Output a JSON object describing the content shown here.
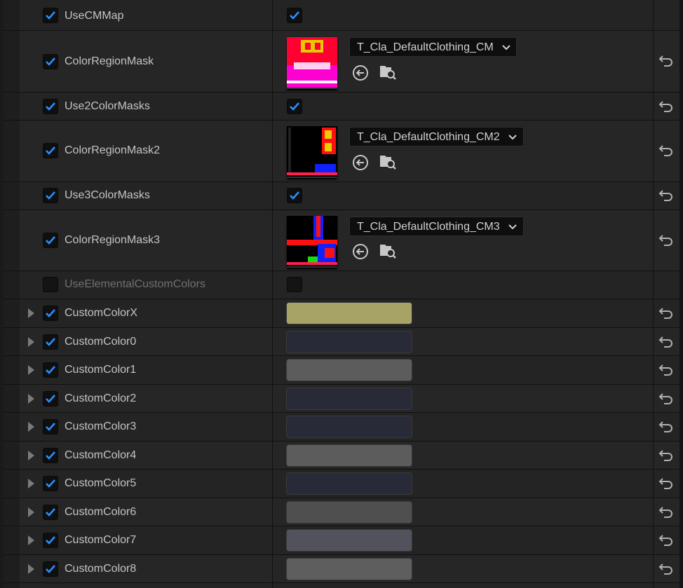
{
  "colors": {
    "accent": "#1e7fe0",
    "check": "#2a8fff",
    "swatch_x": "#a7a364",
    "swatch_navy": "#282b37",
    "swatch_gray": "#5c5c5c",
    "swatch_darkgray": "#4f4f4f"
  },
  "rows": {
    "usecmmap": {
      "label": "UseCMMap"
    },
    "colorregionmask": {
      "label": "ColorRegionMask",
      "asset": "T_Cla_DefaultClothing_CM"
    },
    "use2colormasks": {
      "label": "Use2ColorMasks"
    },
    "colorregionmask2": {
      "label": "ColorRegionMask2",
      "asset": "T_Cla_DefaultClothing_CM2"
    },
    "use3colormasks": {
      "label": "Use3ColorMasks"
    },
    "colorregionmask3": {
      "label": "ColorRegionMask3",
      "asset": "T_Cla_DefaultClothing_CM3"
    },
    "useelemental": {
      "label": "UseElementalCustomColors"
    },
    "customcolorx": {
      "label": "CustomColorX"
    },
    "customcolor0": {
      "label": "CustomColor0"
    },
    "customcolor1": {
      "label": "CustomColor1"
    },
    "customcolor2": {
      "label": "CustomColor2"
    },
    "customcolor3": {
      "label": "CustomColor3"
    },
    "customcolor4": {
      "label": "CustomColor4"
    },
    "customcolor5": {
      "label": "CustomColor5"
    },
    "customcolor6": {
      "label": "CustomColor6"
    },
    "customcolor7": {
      "label": "CustomColor7"
    },
    "customcolor8": {
      "label": "CustomColor8"
    }
  },
  "icons": {
    "checkbox_checked": "checkmark-icon",
    "expander": "triangle-right-icon",
    "reset": "reset-arrow-icon",
    "use_asset": "arrow-left-circle-icon",
    "browse": "folder-search-icon",
    "dropdown": "chevron-down-icon"
  }
}
